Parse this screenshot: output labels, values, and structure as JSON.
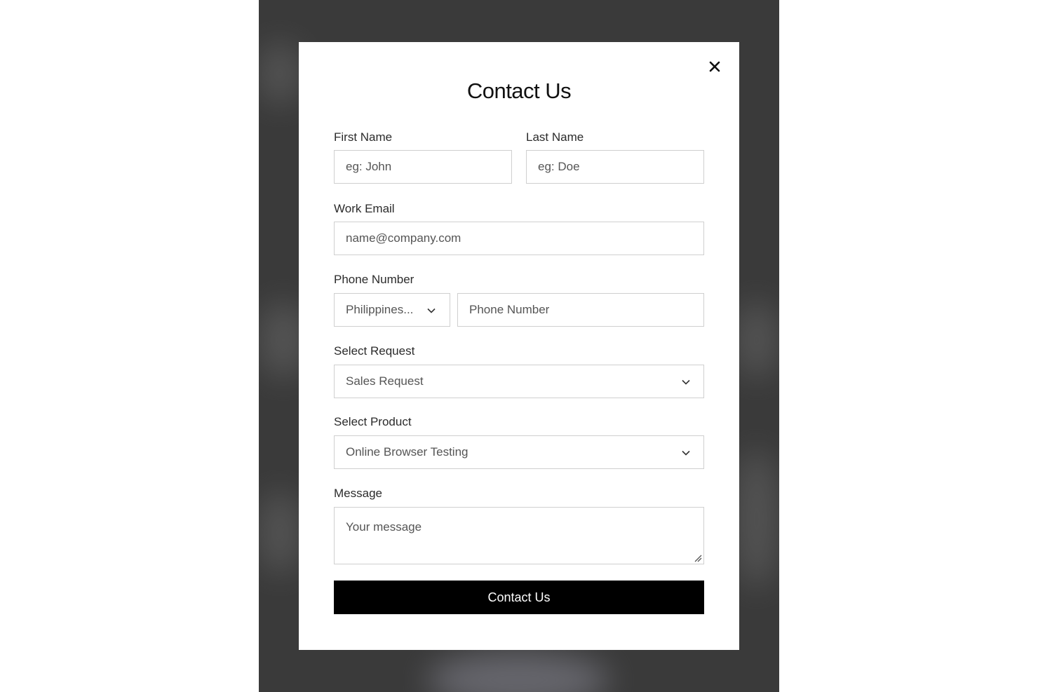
{
  "modal": {
    "title": "Contact Us",
    "close_icon": "close-icon"
  },
  "form": {
    "first_name": {
      "label": "First Name",
      "placeholder": "eg: John"
    },
    "last_name": {
      "label": "Last Name",
      "placeholder": "eg: Doe"
    },
    "work_email": {
      "label": "Work Email",
      "placeholder": "name@company.com"
    },
    "phone": {
      "label": "Phone Number",
      "country_value": "Philippines...",
      "number_placeholder": "Phone Number"
    },
    "request": {
      "label": "Select Request",
      "value": "Sales Request"
    },
    "product": {
      "label": "Select Product",
      "value": "Online Browser Testing"
    },
    "message": {
      "label": "Message",
      "placeholder": "Your message"
    },
    "submit_label": "Contact Us"
  }
}
